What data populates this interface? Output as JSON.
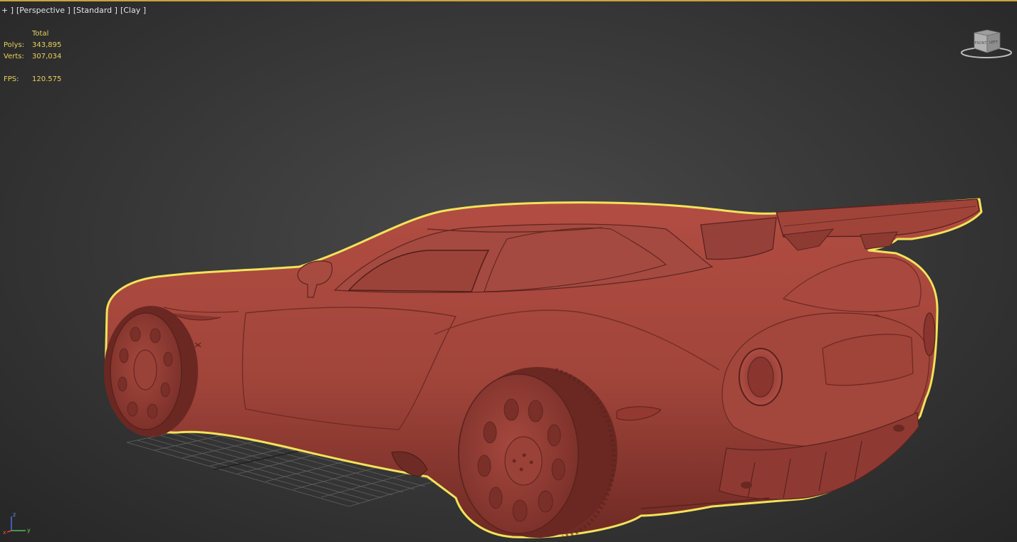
{
  "viewport": {
    "label_plus": "+ ]",
    "label_view": "[Perspective ]",
    "label_shading": "[Standard ]",
    "label_style": "[Clay ]"
  },
  "stats": {
    "header": "Total",
    "polys_label": "Polys:",
    "polys_value": "343,895",
    "verts_label": "Verts:",
    "verts_value": "307,034",
    "fps_label": "FPS:",
    "fps_value": "120.575"
  },
  "viewcube": {
    "face_left": "FRONT",
    "face_right": "LEFT"
  },
  "axis": {
    "x": "x",
    "y": "y",
    "z": "z"
  },
  "colors": {
    "selection_outline": "#f1e35a",
    "clay": "#a5463c",
    "stats_text": "#e8d25a",
    "background": "#3c3c3c"
  }
}
